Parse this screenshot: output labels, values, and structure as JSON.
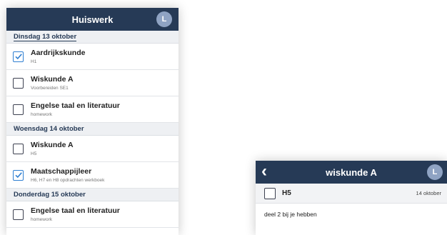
{
  "screen1": {
    "title": "Huiswerk",
    "avatar_letter": "L",
    "days": [
      {
        "label": "Dinsdag 13 oktober",
        "items": [
          {
            "subject": "Aardrijkskunde",
            "note": "H1",
            "checked": true
          },
          {
            "subject": "Wiskunde A",
            "note": "Voorbereiden SE1",
            "checked": false
          },
          {
            "subject": "Engelse taal en literatuur",
            "note": "homework",
            "checked": false
          }
        ]
      },
      {
        "label": "Woensdag 14 oktober",
        "items": [
          {
            "subject": "Wiskunde A",
            "note": "H5",
            "checked": false
          },
          {
            "subject": "Maatschappijleer",
            "note": "H6, H7 en H8 opdrachten werkboek",
            "checked": true
          }
        ]
      },
      {
        "label": "Donderdag 15 oktober",
        "items": [
          {
            "subject": "Engelse taal en literatuur",
            "note": "homework",
            "checked": false
          }
        ]
      }
    ]
  },
  "screen2": {
    "title": "wiskunde A",
    "avatar_letter": "L",
    "back_icon": "chevron-left-icon",
    "item": {
      "name": "H5",
      "date": "14 oktober",
      "checked": false
    },
    "description": "deel 2 bij je hebben"
  },
  "colors": {
    "nav_bg": "#263a56",
    "check": "#2f7fd1",
    "day_bg": "#eef0f3"
  }
}
